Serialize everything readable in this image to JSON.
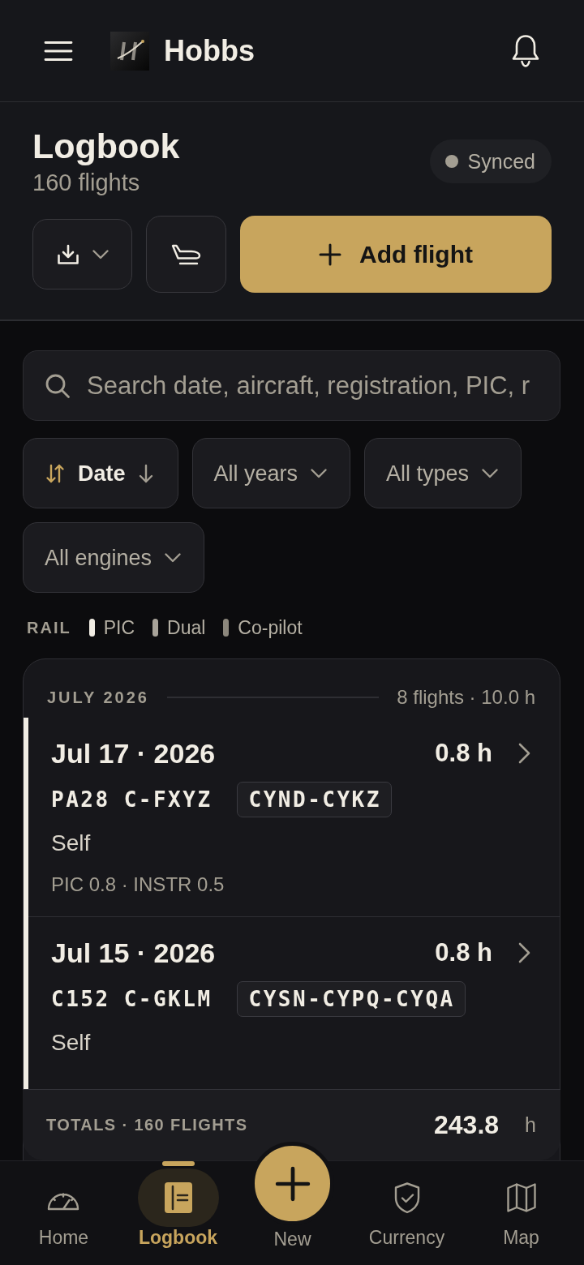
{
  "app_bar": {
    "title": "Hobbs"
  },
  "page_header": {
    "title": "Logbook",
    "subtitle": "160 flights",
    "sync_status": {
      "label": "Synced"
    }
  },
  "actions": [
    {
      "kind": "export"
    },
    {
      "kind": "aircraft"
    },
    {
      "kind": "primary",
      "label": "Add flight"
    }
  ],
  "search": {
    "placeholder": "Search date, aircraft, registration, PIC, r"
  },
  "filters": [
    {
      "kind": "sort",
      "label": "Date"
    },
    {
      "kind": "dropdown",
      "label": "All years"
    },
    {
      "kind": "dropdown",
      "label": "All types"
    },
    {
      "kind": "dropdown",
      "label": "All engines"
    }
  ],
  "legend": {
    "title": "RAIL",
    "items": [
      {
        "label": "PIC",
        "color": "#f1ede4"
      },
      {
        "label": "Dual",
        "color": "#a8a399"
      },
      {
        "label": "Co-pilot",
        "color": "#8c877c"
      }
    ]
  },
  "month_group": {
    "title": "JULY 2026",
    "summary": "8 flights · 10.0 h",
    "flights": [
      {
        "date": "Jul 17 · 2026",
        "duration": "0.8 h",
        "aircraft_type": "PA28",
        "registration": "C-FXYZ",
        "route": "CYND-CYKZ",
        "pilot_in_command": "Self",
        "times": "PIC 0.8 · INSTR 0.5",
        "color": "#f1ede4"
      },
      {
        "date": "Jul 15 · 2026",
        "duration": "0.8 h",
        "aircraft_type": "C152",
        "registration": "C-GKLM",
        "route": "CYSN-CYPQ-CYQA",
        "pilot_in_command": "Self",
        "color": "#f1ede4"
      }
    ]
  },
  "totals": {
    "label": "TOTALS · 160 FLIGHTS",
    "value": "243.8",
    "unit": "h"
  },
  "bottom_nav": [
    {
      "kind": "tab",
      "label": "Home",
      "selected": false
    },
    {
      "kind": "tab",
      "label": "Logbook",
      "selected": true
    },
    {
      "kind": "action",
      "label": "New",
      "selected": false
    },
    {
      "kind": "tab",
      "label": "Currency",
      "selected": false
    },
    {
      "kind": "tab",
      "label": "Map",
      "selected": false
    }
  ]
}
